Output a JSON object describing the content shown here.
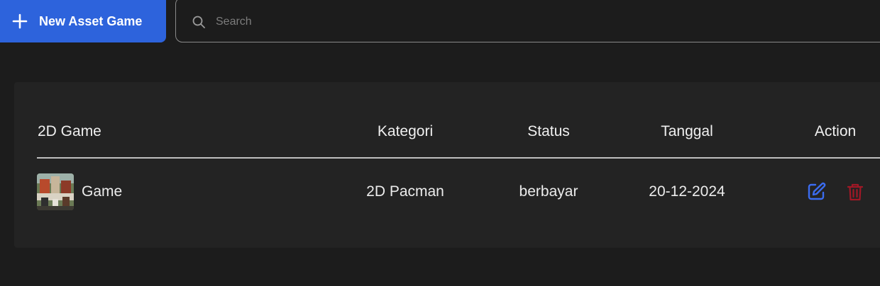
{
  "toolbar": {
    "new_button_label": "New Asset Game",
    "search_placeholder": "Search"
  },
  "table": {
    "columns": [
      "2D Game",
      "Kategori",
      "Status",
      "Tanggal",
      "Action"
    ],
    "rows": [
      {
        "name": "Game",
        "kategori": "2D Pacman",
        "status": "berbayar",
        "tanggal": "20-12-2024"
      }
    ]
  },
  "colors": {
    "primary": "#2d63dc",
    "edit": "#3b6cf0",
    "delete": "#a01826",
    "background": "#1c1c1c",
    "card": "#232323"
  }
}
